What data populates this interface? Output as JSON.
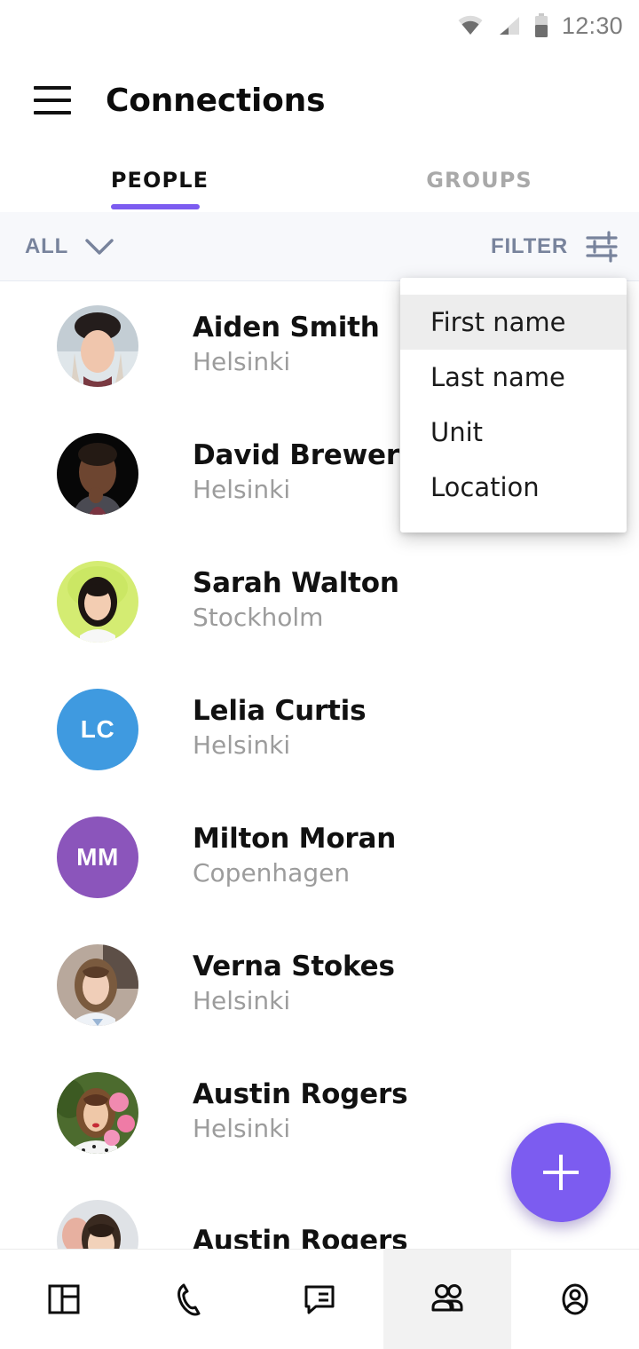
{
  "status_bar": {
    "time": "12:30",
    "icons": [
      "wifi-icon",
      "cellular-signal-icon",
      "battery-icon"
    ],
    "text_color": "#7d7d7d"
  },
  "app_bar": {
    "menu_icon": "hamburger-menu-icon",
    "title": "Connections"
  },
  "tabs": {
    "items": [
      {
        "label": "PEOPLE",
        "active": true
      },
      {
        "label": "GROUPS",
        "active": false
      }
    ],
    "indicator_color": "#7c5cf0"
  },
  "filter_bar": {
    "scope_label": "ALL",
    "scope_icon": "chevron-down-icon",
    "filter_label": "FILTER",
    "filter_icon": "tune-sliders-icon",
    "text_color": "#78839c",
    "background": "#f7f8fb"
  },
  "sort_dropdown": {
    "visible": true,
    "items": [
      {
        "label": "First name",
        "selected": true
      },
      {
        "label": "Last name",
        "selected": false
      },
      {
        "label": "Unit",
        "selected": false
      },
      {
        "label": "Location",
        "selected": false
      }
    ],
    "selected_background": "#ededed"
  },
  "people": [
    {
      "name": "Aiden Smith",
      "location": "Helsinki",
      "avatar_type": "photo",
      "photo": "woman-beanie-snow",
      "initials": "",
      "color": ""
    },
    {
      "name": "David Brewer",
      "location": "Helsinki",
      "avatar_type": "photo",
      "photo": "man-dark-portrait",
      "initials": "",
      "color": ""
    },
    {
      "name": "Sarah Walton",
      "location": "Stockholm",
      "avatar_type": "photo",
      "photo": "woman-green-outdoor",
      "initials": "",
      "color": ""
    },
    {
      "name": "Lelia Curtis",
      "location": "Helsinki",
      "avatar_type": "initials",
      "photo": "",
      "initials": "LC",
      "color": "#3f9ae0"
    },
    {
      "name": "Milton Moran",
      "location": "Copenhagen",
      "avatar_type": "initials",
      "photo": "",
      "initials": "MM",
      "color": "#8b55bb"
    },
    {
      "name": "Verna Stokes",
      "location": "Helsinki",
      "avatar_type": "photo",
      "photo": "woman-brown-hair",
      "initials": "",
      "color": ""
    },
    {
      "name": "Austin Rogers",
      "location": "Helsinki",
      "avatar_type": "photo",
      "photo": "woman-pink-flowers",
      "initials": "",
      "color": ""
    },
    {
      "name": "Austin Rogers",
      "location": "",
      "avatar_type": "photo",
      "photo": "woman-dark-hair",
      "initials": "",
      "color": ""
    }
  ],
  "fab": {
    "icon": "plus-icon",
    "color": "#7c5cf0"
  },
  "bottom_nav": {
    "items": [
      {
        "icon": "dashboard-icon",
        "active": false
      },
      {
        "icon": "phone-icon",
        "active": false
      },
      {
        "icon": "chat-icon",
        "active": false
      },
      {
        "icon": "people-icon",
        "active": true
      },
      {
        "icon": "account-icon",
        "active": false
      }
    ],
    "active_background": "#f2f2f2"
  }
}
